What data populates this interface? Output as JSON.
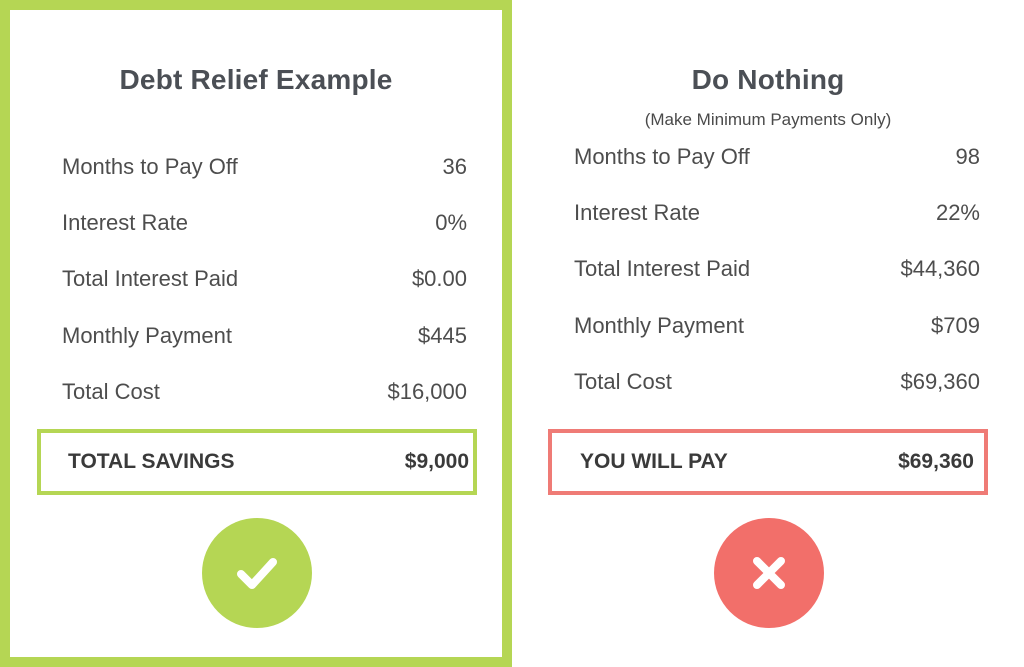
{
  "left": {
    "title": "Debt Relief Example",
    "rows": [
      {
        "label": "Months to Pay Off",
        "value": "36"
      },
      {
        "label": "Interest Rate",
        "value": "0%"
      },
      {
        "label": "Total Interest Paid",
        "value": "$0.00"
      },
      {
        "label": "Monthly Payment",
        "value": "$445"
      },
      {
        "label": "Total Cost",
        "value": "$16,000"
      }
    ],
    "summary": {
      "label": "TOTAL SAVINGS",
      "value": "$9,000"
    },
    "icon": "check-icon",
    "color": "#b5d654"
  },
  "right": {
    "title": "Do Nothing",
    "subtitle": "(Make Minimum Payments Only)",
    "rows": [
      {
        "label": "Months to Pay Off",
        "value": "98"
      },
      {
        "label": "Interest Rate",
        "value": "22%"
      },
      {
        "label": "Total Interest Paid",
        "value": "$44,360"
      },
      {
        "label": "Monthly Payment",
        "value": "$709"
      },
      {
        "label": "Total Cost",
        "value": "$69,360"
      }
    ],
    "summary": {
      "label": "YOU WILL PAY",
      "value": "$69,360"
    },
    "icon": "x-icon",
    "color": "#f26f6a"
  }
}
